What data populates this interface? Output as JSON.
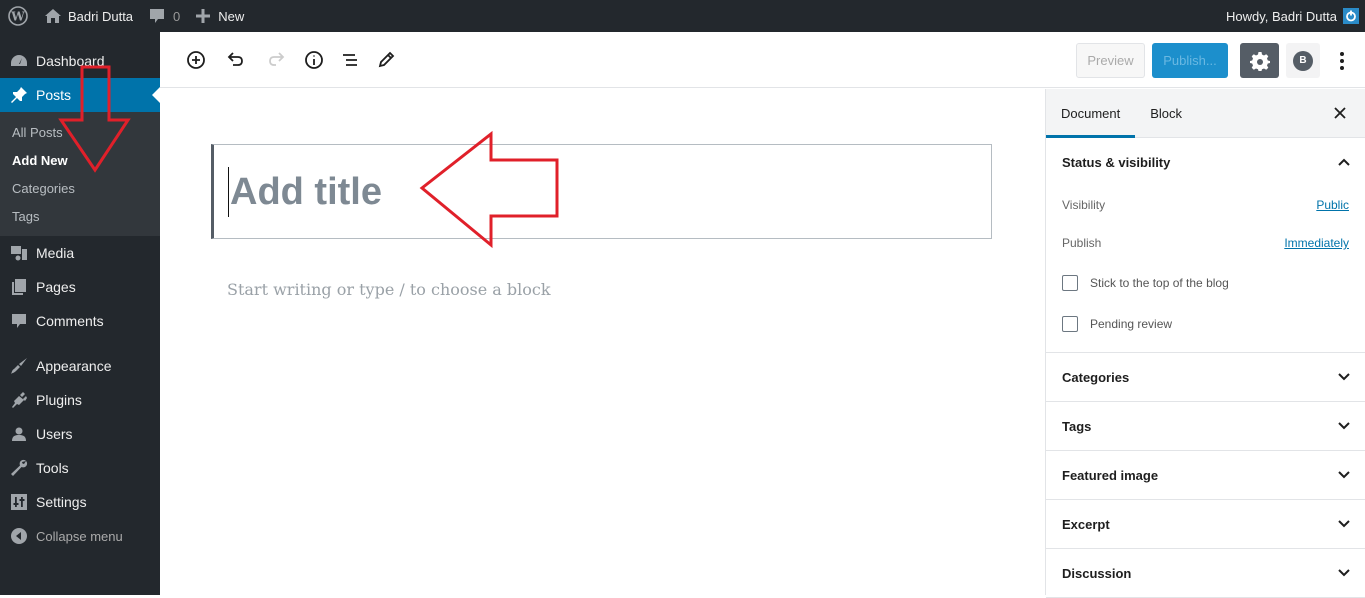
{
  "adminbar": {
    "site_name": "Badri Dutta",
    "comments_count": "0",
    "new_label": "New",
    "howdy": "Howdy, Badri Dutta"
  },
  "sidebar": {
    "items": [
      {
        "label": "Dashboard",
        "icon": "dashboard-icon"
      },
      {
        "label": "Posts",
        "icon": "pin-icon",
        "active": true
      },
      {
        "label": "Media",
        "icon": "media-icon"
      },
      {
        "label": "Pages",
        "icon": "pages-icon"
      },
      {
        "label": "Comments",
        "icon": "comment-icon"
      },
      {
        "label": "Appearance",
        "icon": "paintbrush-icon"
      },
      {
        "label": "Plugins",
        "icon": "plugin-icon"
      },
      {
        "label": "Users",
        "icon": "user-icon"
      },
      {
        "label": "Tools",
        "icon": "wrench-icon"
      },
      {
        "label": "Settings",
        "icon": "settings-icon"
      }
    ],
    "submenu": [
      "All Posts",
      "Add New",
      "Categories",
      "Tags"
    ],
    "submenu_current": "Add New",
    "collapse_label": "Collapse menu"
  },
  "toolbar": {
    "preview_label": "Preview",
    "publish_label": "Publish...",
    "avatar_letter": "B"
  },
  "editor": {
    "title_placeholder": "Add title",
    "body_placeholder": "Start writing or type / to choose a block"
  },
  "settings_panel": {
    "tabs": [
      "Document",
      "Block"
    ],
    "active_tab": "Document",
    "status_section": {
      "title": "Status & visibility",
      "visibility_label": "Visibility",
      "visibility_value": "Public",
      "publish_label": "Publish",
      "publish_value": "Immediately",
      "sticky_label": "Stick to the top of the blog",
      "sticky_checked": false,
      "pending_label": "Pending review",
      "pending_checked": false
    },
    "sections": [
      "Categories",
      "Tags",
      "Featured image",
      "Excerpt",
      "Discussion"
    ]
  },
  "colors": {
    "admin_dark": "#23282d",
    "accent": "#0073aa",
    "annotation_arrow": "#e0202a"
  }
}
